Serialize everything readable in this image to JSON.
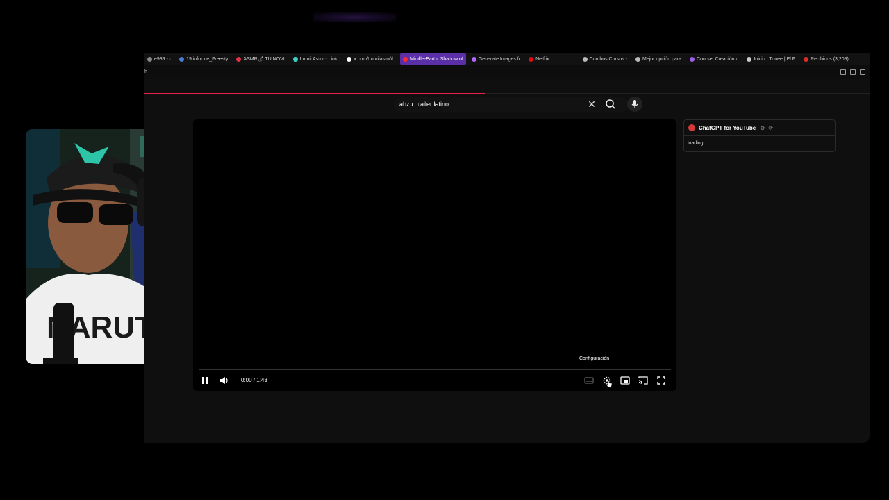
{
  "bookmarks": [
    {
      "label": "e939 - ·",
      "color": "#888888",
      "active": false
    },
    {
      "label": "19.informe_Freesty",
      "color": "#4a7bd6",
      "active": false
    },
    {
      "label": "ASMR🌶 TÚ NOVI",
      "color": "#e0304a",
      "active": false
    },
    {
      "label": "Lumii Asmr - Linkt",
      "color": "#3ad0c0",
      "active": false
    },
    {
      "label": "x.com/Lumiiasmr\\h",
      "color": "#ffffff",
      "active": false
    },
    {
      "label": "Middle-Earth: Shadow of",
      "color": "#ff2a2a",
      "active": true
    },
    {
      "label": "Generate Images fr",
      "color": "#b067ff",
      "active": false
    },
    {
      "label": "Netflix",
      "color": "#e50914",
      "active": false
    },
    {
      "label": "Combos Cursos -",
      "color": "#bbbbbb",
      "active": false
    },
    {
      "label": "Mejor opción para",
      "color": "#bbbbbb",
      "active": false
    },
    {
      "label": "Course: Creación d",
      "color": "#a35ee8",
      "active": false
    },
    {
      "label": "Inicio | Tunee | El F",
      "color": "#cccccc",
      "active": false
    },
    {
      "label": "Recibidos (3,209)",
      "color": "#d93025",
      "active": false
    }
  ],
  "toolbar": {
    "address_fragment": "h"
  },
  "loading_progress": 0.47,
  "search": {
    "query": "abzu  trailer latino",
    "clear_symbol": "✕"
  },
  "player": {
    "time": "0:00 / 1:43",
    "tooltip": "Configuración",
    "progress": 0
  },
  "chatgpt_panel": {
    "title": "ChatGPT for YouTube",
    "loading_text": "loading..."
  },
  "webcam": {
    "shirt_text": "NARUTO"
  }
}
